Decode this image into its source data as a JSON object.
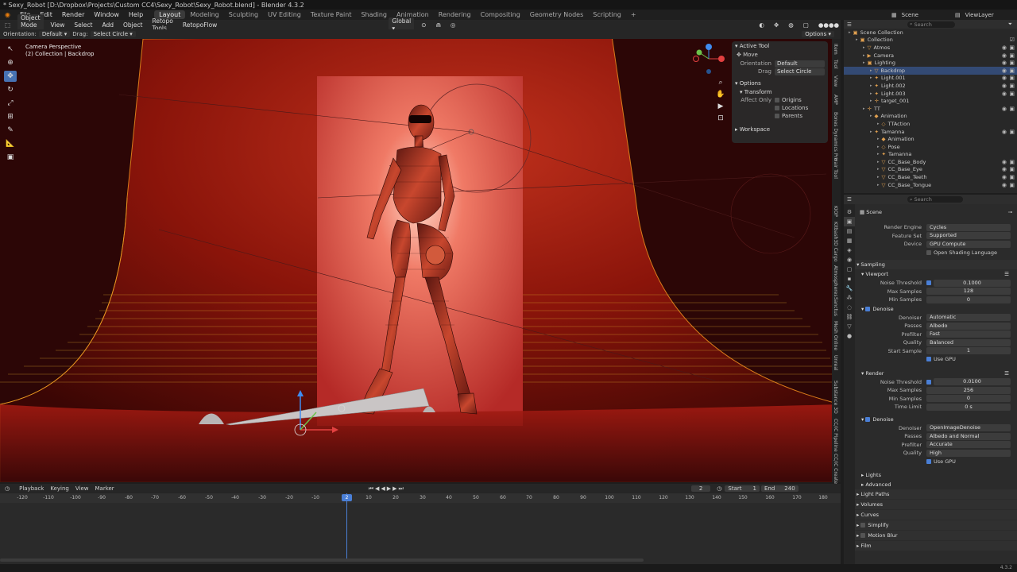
{
  "title": "* Sexy_Robot [D:\\Dropbox\\Projects\\Custom CC4\\Sexy_Robot\\Sexy_Robot.blend] - Blender 4.3.2",
  "menu": [
    "File",
    "Edit",
    "Render",
    "Window",
    "Help"
  ],
  "workspaces": [
    "Layout",
    "Modeling",
    "Sculpting",
    "UV Editing",
    "Texture Paint",
    "Shading",
    "Animation",
    "Rendering",
    "Compositing",
    "Geometry Nodes",
    "Scripting"
  ],
  "active_workspace": "Layout",
  "scene_name": "Scene",
  "viewlayer": "ViewLayer",
  "viewport": {
    "mode": "Object Mode",
    "menus": [
      "View",
      "Select",
      "Add",
      "Object",
      "Retopo Tools",
      "RetopoFlow"
    ],
    "orientation_label": "Orientation:",
    "orientation": "Default",
    "drag_label": "Drag:",
    "drag": "Select Circle",
    "transform_orientation": "Global",
    "options": "Options",
    "info1": "Camera Perspective",
    "info2": "(2) Collection | Backdrop"
  },
  "npanel": {
    "active_tool": "Active Tool",
    "move": "Move",
    "orientation_label": "Orientation",
    "orientation": "Default",
    "drag_label": "Drag",
    "drag": "Select Circle",
    "options": "Options",
    "transform": "Transform",
    "affect_only": "Affect Only",
    "origins": "Origins",
    "locations": "Locations",
    "parents": "Parents",
    "workspace": "Workspace"
  },
  "sidetabs": [
    "Item",
    "Tool",
    "View",
    "AMP",
    "Bones Dynamics Pro",
    "Hair Tool",
    "KIOP",
    "Kitbash3D Cargo",
    "Atmospheres",
    "Sanctus",
    "Mesh Online",
    "Unreal",
    "Substance 3D",
    "CC/iC Pipeline",
    "CC/iC Create"
  ],
  "outliner": {
    "search_placeholder": "Search",
    "rows": [
      {
        "label": "Scene Collection",
        "indent": 0,
        "icon": "▣"
      },
      {
        "label": "Collection",
        "indent": 1,
        "icon": "▣",
        "check": true
      },
      {
        "label": "Atmos",
        "indent": 2,
        "icon": "▽",
        "eye": true
      },
      {
        "label": "Camera",
        "indent": 2,
        "icon": "▶",
        "eye": true
      },
      {
        "label": "Lighting",
        "indent": 2,
        "icon": "▣",
        "eye": true
      },
      {
        "label": "Backdrop",
        "indent": 3,
        "icon": "▽",
        "eye": true,
        "selected": true
      },
      {
        "label": "Light.001",
        "indent": 3,
        "icon": "✦",
        "eye": true
      },
      {
        "label": "Light.002",
        "indent": 3,
        "icon": "✦",
        "eye": true
      },
      {
        "label": "Light.003",
        "indent": 3,
        "icon": "✦",
        "eye": true
      },
      {
        "label": "target_001",
        "indent": 3,
        "icon": "✛"
      },
      {
        "label": "TT",
        "indent": 2,
        "icon": "✛",
        "eye": true
      },
      {
        "label": "Animation",
        "indent": 3,
        "icon": "◆"
      },
      {
        "label": "TTAction",
        "indent": 4,
        "icon": "◇"
      },
      {
        "label": "Tamanna",
        "indent": 3,
        "icon": "✦",
        "eye": true
      },
      {
        "label": "Animation",
        "indent": 4,
        "icon": "◆"
      },
      {
        "label": "Pose",
        "indent": 4,
        "icon": "◇"
      },
      {
        "label": "Tamanna",
        "indent": 4,
        "icon": "✦"
      },
      {
        "label": "CC_Base_Body",
        "indent": 4,
        "icon": "▽",
        "eye": true
      },
      {
        "label": "CC_Base_Eye",
        "indent": 4,
        "icon": "▽",
        "eye": true
      },
      {
        "label": "CC_Base_Teeth",
        "indent": 4,
        "icon": "▽",
        "eye": true
      },
      {
        "label": "CC_Base_Tongue",
        "indent": 4,
        "icon": "▽",
        "eye": true
      }
    ]
  },
  "properties": {
    "search_placeholder": "Search",
    "scene": "Scene",
    "render_engine_label": "Render Engine",
    "render_engine": "Cycles",
    "feature_set_label": "Feature Set",
    "feature_set": "Supported",
    "device_label": "Device",
    "device": "GPU Compute",
    "osl": "Open Shading Language",
    "sampling": "Sampling",
    "viewport": "Viewport",
    "noise_threshold_label": "Noise Threshold",
    "vp_noise": "0.1000",
    "max_samples_label": "Max Samples",
    "vp_max": "128",
    "min_samples_label": "Min Samples",
    "vp_min": "0",
    "denoise": "Denoise",
    "denoiser_label": "Denoiser",
    "vp_denoiser": "Automatic",
    "passes_label": "Passes",
    "vp_passes": "Albedo",
    "prefilter_label": "Prefilter",
    "vp_prefilter": "Fast",
    "quality_label": "Quality",
    "vp_quality": "Balanced",
    "start_sample_label": "Start Sample",
    "vp_start": "1",
    "use_gpu": "Use GPU",
    "render": "Render",
    "r_noise": "0.0100",
    "r_max": "256",
    "r_min": "0",
    "time_limit_label": "Time Limit",
    "r_time": "0 s",
    "r_denoiser": "OpenImageDenoise",
    "r_passes": "Albedo and Normal",
    "r_prefilter": "Accurate",
    "r_quality": "High",
    "lights": "Lights",
    "advanced": "Advanced",
    "light_paths": "Light Paths",
    "volumes": "Volumes",
    "curves": "Curves",
    "simplify": "Simplify",
    "motion_blur": "Motion Blur",
    "film": "Film"
  },
  "timeline": {
    "menus": [
      "Playback",
      "Keying",
      "View",
      "Marker"
    ],
    "current_frame": "2",
    "start_label": "Start",
    "start": "1",
    "end_label": "End",
    "end": "240",
    "ticks": [
      "-120",
      "-110",
      "-100",
      "-90",
      "-80",
      "-70",
      "-60",
      "-50",
      "-40",
      "-30",
      "-20",
      "-10",
      "2",
      "10",
      "20",
      "30",
      "40",
      "50",
      "60",
      "70",
      "80",
      "90",
      "100",
      "110",
      "120",
      "130",
      "140",
      "150",
      "160",
      "170",
      "180"
    ]
  },
  "version": "4.3.2",
  "colors": {
    "accent": "#4772b3",
    "selection": "#334a74",
    "backdrop": "#b01e0e"
  }
}
